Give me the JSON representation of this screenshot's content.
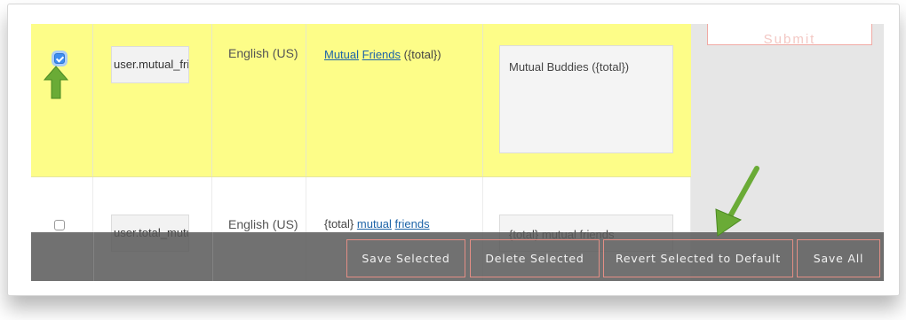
{
  "submit": {
    "label": "Submit"
  },
  "rows": [
    {
      "checked": true,
      "key": "user.mutual_friends",
      "language": "English (US)",
      "original_parts": [
        "Mutual",
        "Friends",
        "({total})"
      ],
      "translation": "Mutual Buddies ({total})"
    },
    {
      "checked": false,
      "key": "user.total_mutual_friends",
      "language": "English (US)",
      "original_parts": [
        "{total}",
        "mutual",
        "friends"
      ],
      "translation": "{total} mutual friends"
    }
  ],
  "actions": {
    "save_selected": "Save Selected",
    "delete_selected": "Delete Selected",
    "revert_selected": "Revert Selected to Default",
    "save_all": "Save All"
  },
  "colors": {
    "selected_row": "#fdfd88",
    "button_border": "#e38e85",
    "arrow_green": "#6aab36",
    "checkbox_blue": "#3d8ef0"
  },
  "annotations": [
    "green-arrow-checkbox",
    "green-arrow-revert-button"
  ]
}
